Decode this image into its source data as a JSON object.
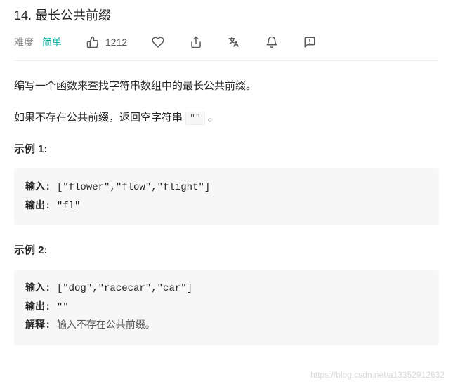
{
  "title": "14. 最长公共前缀",
  "meta": {
    "difficulty_label": "难度",
    "difficulty_value": "简单",
    "likes_count": "1212"
  },
  "problem": {
    "p1": "编写一个函数来查找字符串数组中的最长公共前缀。",
    "p2_pre": "如果不存在公共前缀，返回空字符串 ",
    "p2_code": "\"\"",
    "p2_post": " 。"
  },
  "examples": [
    {
      "heading": "示例 1:",
      "input_label": "输入: ",
      "input_value": "[\"flower\",\"flow\",\"flight\"]",
      "output_label": "输出: ",
      "output_value": "\"fl\""
    },
    {
      "heading": "示例 2:",
      "input_label": "输入: ",
      "input_value": "[\"dog\",\"racecar\",\"car\"]",
      "output_label": "输出: ",
      "output_value": "\"\"",
      "explain_label": "解释: ",
      "explain_value": "输入不存在公共前缀。"
    }
  ],
  "watermark": "https://blog.csdn.net/a13352912632"
}
